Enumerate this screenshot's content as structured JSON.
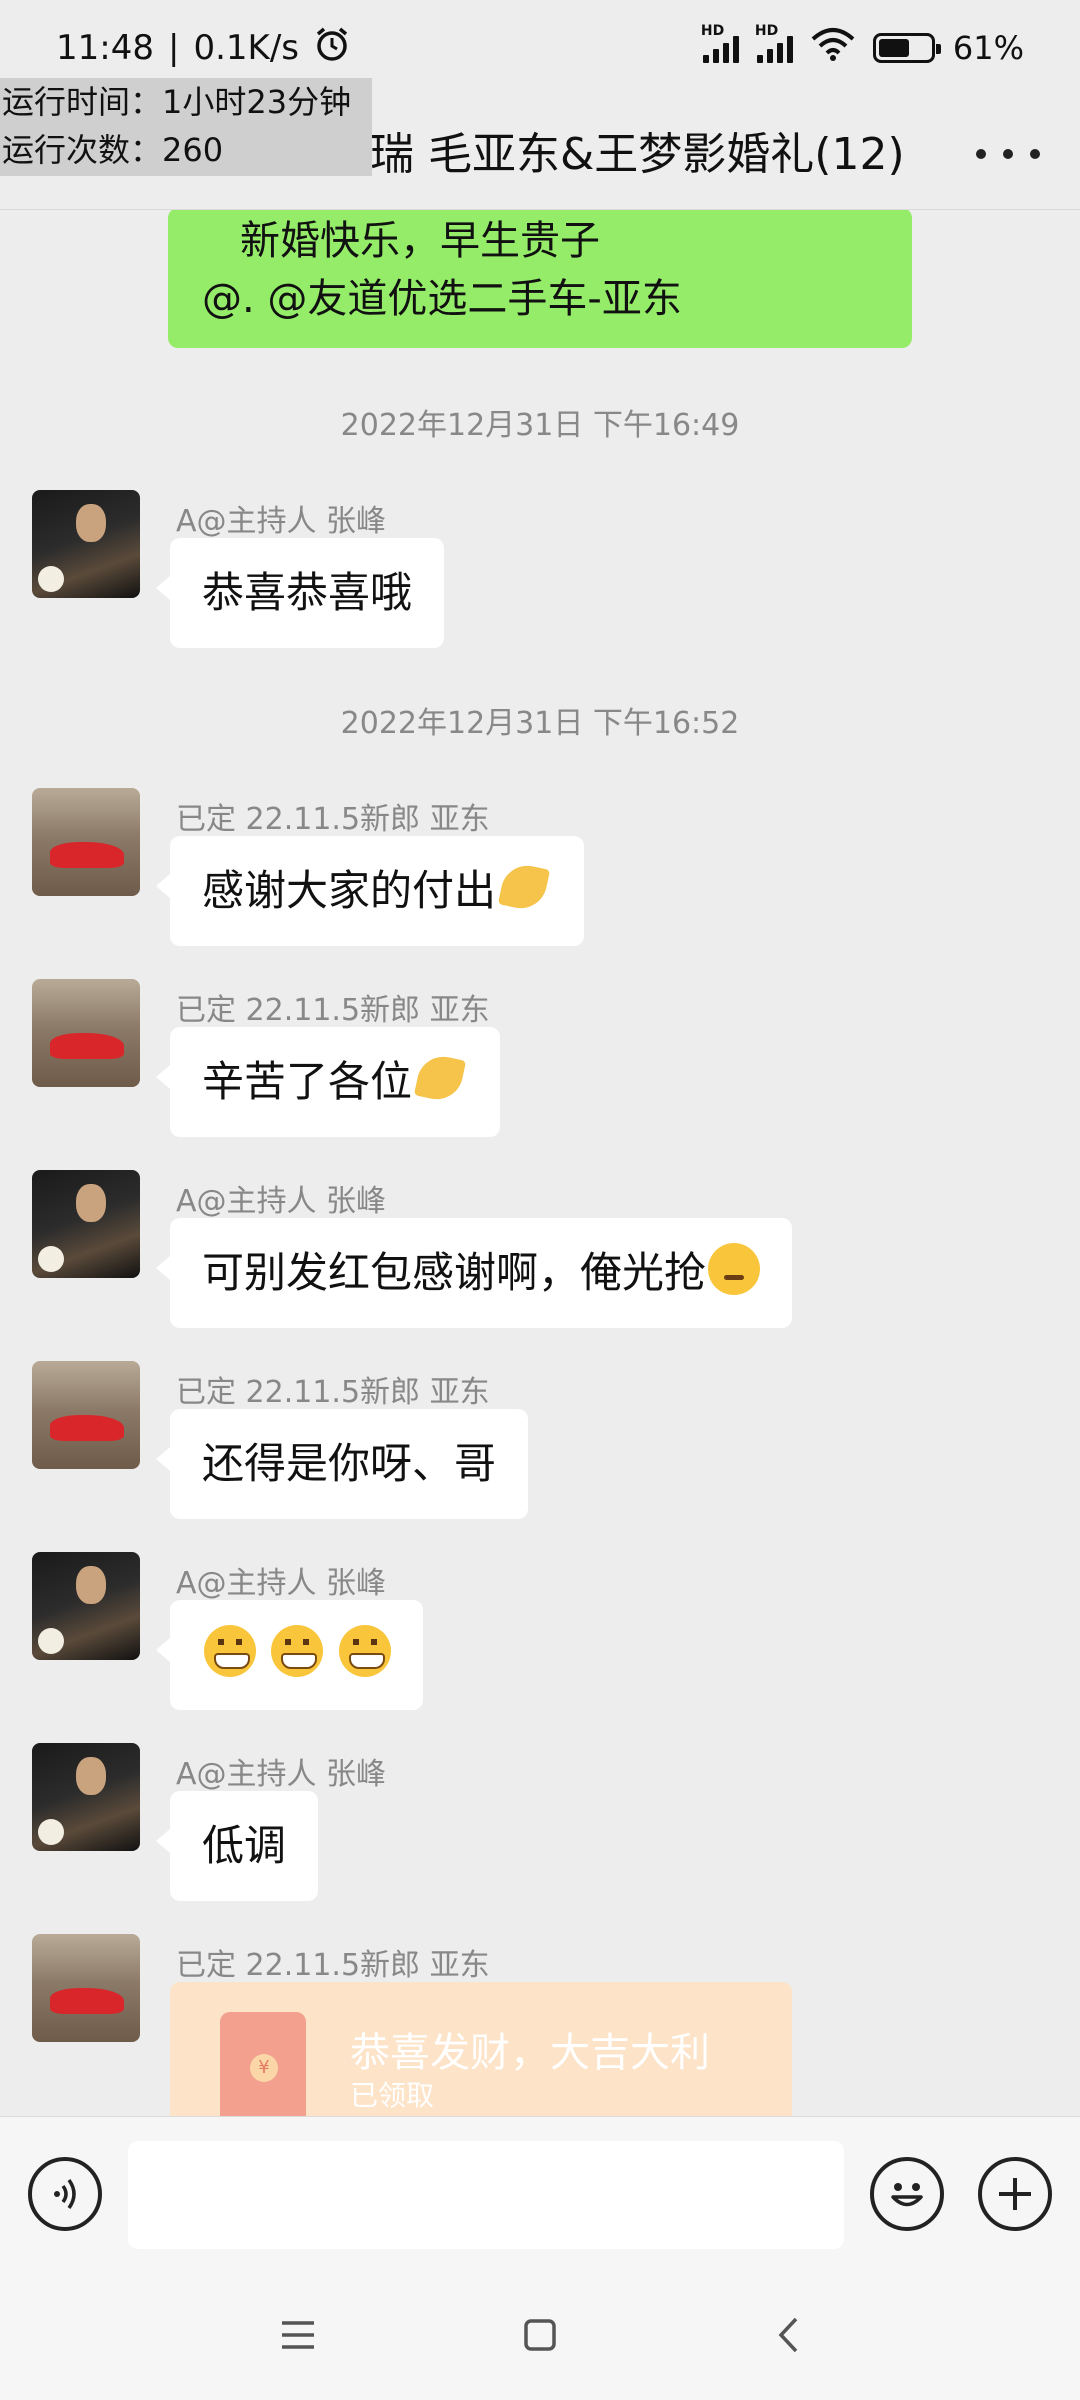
{
  "status_bar": {
    "time": "11:48",
    "separator": "|",
    "speed": "0.1K/s",
    "battery": "61%",
    "battery_level": 0.61,
    "signal_labels": [
      "HD",
      "HD"
    ]
  },
  "overlay": {
    "line1": "运行时间：1小时23分钟",
    "line2": "运行次数：260"
  },
  "header": {
    "title": "瑞 毛亚东&王梦影婚礼(12)"
  },
  "chat": {
    "top_bubble": {
      "line1": "新婚快乐，早生贵子",
      "line2": "@. @友道优选二手车-亚东"
    },
    "timestamps": [
      "2022年12月31日 下午16:49",
      "2022年12月31日 下午16:52"
    ],
    "messages": [
      {
        "sender": "A@主持人 张峰",
        "text": "恭喜恭喜哦",
        "avatar": "host"
      },
      {
        "sender": "已定 22.11.5新郎 亚东",
        "text": "感谢大家的付出",
        "emoji": "folded-hands",
        "avatar": "groom"
      },
      {
        "sender": "已定 22.11.5新郎 亚东",
        "text": "辛苦了各位",
        "emoji": "folded-hands",
        "avatar": "groom"
      },
      {
        "sender": "A@主持人 张峰",
        "text": "可别发红包感谢啊，俺光抢",
        "emoji": "kissing-face",
        "avatar": "host"
      },
      {
        "sender": "已定 22.11.5新郎 亚东",
        "text": "还得是你呀、哥",
        "avatar": "groom"
      },
      {
        "sender": "A@主持人 张峰",
        "text": "",
        "emoji": "grinning-face x3",
        "avatar": "host"
      },
      {
        "sender": "A@主持人 张峰",
        "text": "低调",
        "avatar": "host"
      },
      {
        "sender": "已定 22.11.5新郎 亚东",
        "avatar": "groom"
      }
    ],
    "red_packet": {
      "title": "恭喜发财，大吉大利",
      "status": "已领取",
      "seal": "¥"
    }
  },
  "input_bar": {
    "value": "",
    "placeholder": ""
  },
  "colors": {
    "background": "#ededed",
    "sent_bubble": "#95ec69",
    "received_bubble": "#ffffff",
    "red_packet": "#fde3c8"
  }
}
